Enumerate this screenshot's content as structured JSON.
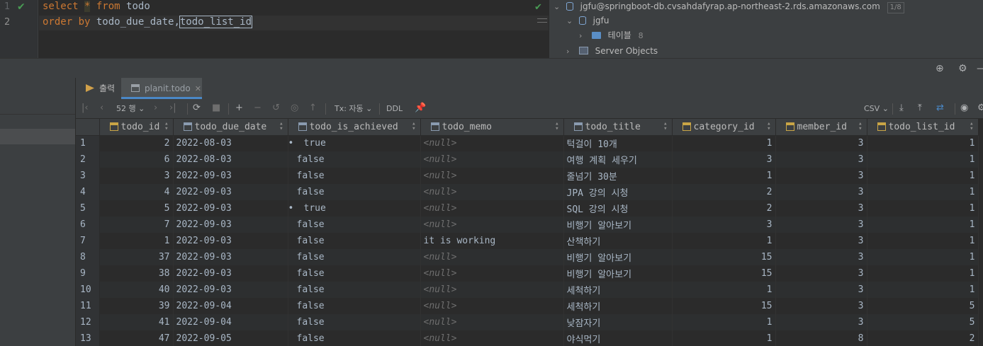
{
  "editor": {
    "lines": [
      {
        "num": "1",
        "tokens": [
          {
            "t": "select ",
            "c": "kw"
          },
          {
            "t": "*",
            "c": "star"
          },
          {
            "t": " from ",
            "c": "kw"
          },
          {
            "t": "todo",
            "c": "ident"
          }
        ]
      },
      {
        "num": "2",
        "tokens": [
          {
            "t": "order by ",
            "c": "kw"
          },
          {
            "t": "todo_due_date",
            "c": "ident"
          },
          {
            "t": ",",
            "c": "ident"
          },
          {
            "t": "todo_list_id",
            "c": "ident boxed"
          }
        ]
      }
    ]
  },
  "tree": {
    "datasource": "jgfu@springboot-db.cvsahdafyrap.ap-northeast-2.rds.amazonaws.com",
    "datasource_badge": "1/8",
    "schema": "jgfu",
    "tables_label": "테이블",
    "tables_count": "8",
    "server_objects": "Server Objects"
  },
  "tabs": [
    {
      "label": "출력",
      "active": false
    },
    {
      "label": "planit.todo",
      "active": true
    }
  ],
  "toolbar": {
    "rows_label": "52 행",
    "tx_label": "Tx: 자동",
    "ddl_label": "DDL",
    "export_format": "CSV"
  },
  "grid": {
    "columns": [
      {
        "name": "todo_id",
        "key": true,
        "width": 104
      },
      {
        "name": "todo_due_date",
        "key": false,
        "width": 162
      },
      {
        "name": "todo_is_achieved",
        "key": false,
        "width": 187
      },
      {
        "name": "todo_memo",
        "key": false,
        "width": 202
      },
      {
        "name": "todo_title",
        "key": false,
        "width": 153
      },
      {
        "name": "category_id",
        "key": true,
        "width": 146
      },
      {
        "name": "member_id",
        "key": true,
        "width": 129
      },
      {
        "name": "todo_list_id",
        "key": true,
        "width": 157
      }
    ],
    "null_text": "<null>",
    "rows": [
      {
        "n": "1",
        "id": "2",
        "due": "2022-08-03",
        "ach": "true",
        "memo": null,
        "title": "턱걸이 10개",
        "cat": "1",
        "mem": "3",
        "list": "1"
      },
      {
        "n": "2",
        "id": "6",
        "due": "2022-08-03",
        "ach": "false",
        "memo": null,
        "title": "여행 계획 세우기",
        "cat": "3",
        "mem": "3",
        "list": "1"
      },
      {
        "n": "3",
        "id": "3",
        "due": "2022-09-03",
        "ach": "false",
        "memo": null,
        "title": "줄넘기 30분",
        "cat": "1",
        "mem": "3",
        "list": "1"
      },
      {
        "n": "4",
        "id": "4",
        "due": "2022-09-03",
        "ach": "false",
        "memo": null,
        "title": "JPA 강의 시청",
        "cat": "2",
        "mem": "3",
        "list": "1"
      },
      {
        "n": "5",
        "id": "5",
        "due": "2022-09-03",
        "ach": "true",
        "memo": null,
        "title": "SQL 강의 시청",
        "cat": "2",
        "mem": "3",
        "list": "1"
      },
      {
        "n": "6",
        "id": "7",
        "due": "2022-09-03",
        "ach": "false",
        "memo": null,
        "title": "비행기 알아보기",
        "cat": "3",
        "mem": "3",
        "list": "1"
      },
      {
        "n": "7",
        "id": "1",
        "due": "2022-09-03",
        "ach": "false",
        "memo": "it is working",
        "title": "산책하기",
        "cat": "1",
        "mem": "3",
        "list": "1"
      },
      {
        "n": "8",
        "id": "37",
        "due": "2022-09-03",
        "ach": "false",
        "memo": null,
        "title": "비행기 알아보기",
        "cat": "15",
        "mem": "3",
        "list": "1"
      },
      {
        "n": "9",
        "id": "38",
        "due": "2022-09-03",
        "ach": "false",
        "memo": null,
        "title": "비행기 알아보기",
        "cat": "15",
        "mem": "3",
        "list": "1"
      },
      {
        "n": "10",
        "id": "40",
        "due": "2022-09-03",
        "ach": "false",
        "memo": null,
        "title": "세척하기",
        "cat": "1",
        "mem": "3",
        "list": "1"
      },
      {
        "n": "11",
        "id": "39",
        "due": "2022-09-04",
        "ach": "false",
        "memo": null,
        "title": "세척하기",
        "cat": "15",
        "mem": "3",
        "list": "5"
      },
      {
        "n": "12",
        "id": "41",
        "due": "2022-09-04",
        "ach": "false",
        "memo": null,
        "title": "낮잠자기",
        "cat": "1",
        "mem": "3",
        "list": "5"
      },
      {
        "n": "13",
        "id": "47",
        "due": "2022-09-05",
        "ach": "false",
        "memo": null,
        "title": "야식먹기",
        "cat": "1",
        "mem": "8",
        "list": "2"
      }
    ]
  }
}
